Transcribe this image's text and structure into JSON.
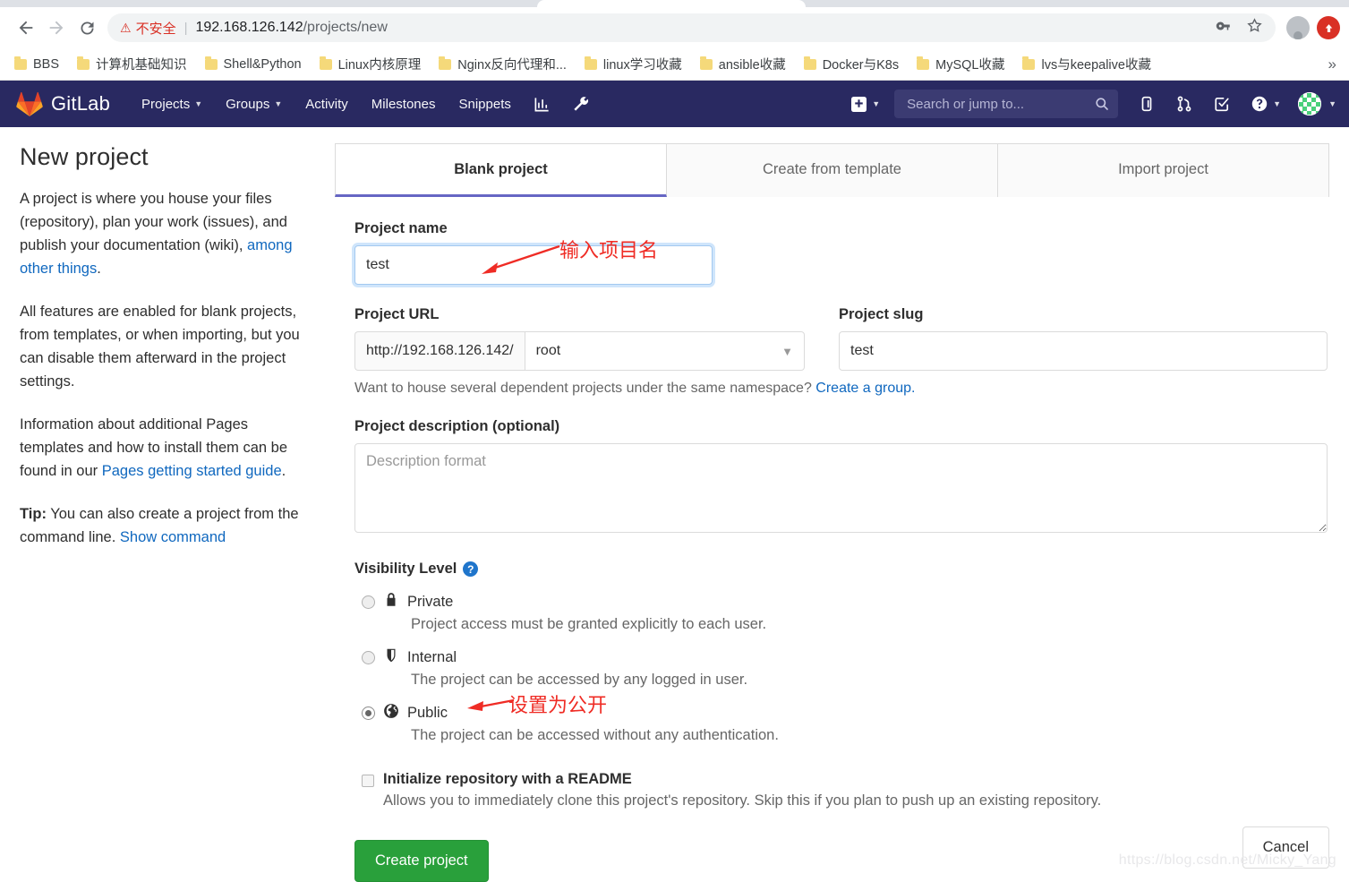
{
  "browser": {
    "back_icon": "back-arrow-icon",
    "forward_icon": "forward-arrow-icon",
    "reload_icon": "reload-icon",
    "security_warning": "不安全",
    "url_host": "192.168.126.142",
    "url_path": "/projects/new",
    "key_icon": "key-icon",
    "star_icon": "star-icon",
    "profile_icon": "profile-avatar-icon",
    "extension_icon": "extension-icon",
    "bookmarks": [
      "BBS",
      "计算机基础知识",
      "Shell&Python",
      "Linux内核原理",
      "Nginx反向代理和...",
      "linux学习收藏",
      "ansible收藏",
      "Docker与K8s",
      "MySQL收藏",
      "lvs与keepalive收藏"
    ],
    "bookmarks_overflow": "»"
  },
  "gitlab_nav": {
    "brand": "GitLab",
    "links": [
      {
        "label": "Projects",
        "has_caret": true
      },
      {
        "label": "Groups",
        "has_caret": true
      },
      {
        "label": "Activity",
        "has_caret": false
      },
      {
        "label": "Milestones",
        "has_caret": false
      },
      {
        "label": "Snippets",
        "has_caret": false
      }
    ],
    "icon_links": [
      "analytics-icon",
      "wrench-icon"
    ],
    "plus_icon": "plus-square-icon",
    "search_placeholder": "Search or jump to...",
    "search_value": "",
    "search_icon": "search-icon",
    "right_icons": [
      "issues-icon",
      "merge-requests-icon",
      "todos-icon",
      "help-icon"
    ],
    "avatar": "user-avatar-identicon",
    "nav_bg": "#292961"
  },
  "sidebar": {
    "title": "New project",
    "p1_a": "A project is where you house your files (repository), plan your work (issues), and publish your documentation (wiki), ",
    "p1_link": "among other things",
    "p1_b": ".",
    "p2": "All features are enabled for blank projects, from templates, or when importing, but you can disable them afterward in the project settings.",
    "p3_a": "Information about additional Pages templates and how to install them can be found in our ",
    "p3_link": "Pages getting started guide",
    "p3_b": ".",
    "p4_tip": "Tip:",
    "p4_a": " You can also create a project from the command line. ",
    "p4_link": "Show command"
  },
  "tabs": [
    {
      "label": "Blank project",
      "active": true
    },
    {
      "label": "Create from template",
      "active": false
    },
    {
      "label": "Import project",
      "active": false
    }
  ],
  "form": {
    "project_name_label": "Project name",
    "project_name_value": "test",
    "project_name_placeholder": "",
    "project_url_label": "Project URL",
    "url_prefix": "http://192.168.126.142/",
    "namespace_value": "root",
    "namespace_caret": "chevron-down-icon",
    "project_slug_label": "Project slug",
    "project_slug_value": "test",
    "namespace_hint_text": "Want to house several dependent projects under the same namespace? ",
    "namespace_hint_link": "Create a group.",
    "description_label": "Project description (optional)",
    "description_placeholder": "Description format",
    "description_value": "",
    "visibility_label": "Visibility Level",
    "visibility_help_icon": "question-mark-icon",
    "visibility_options": [
      {
        "name": "Private",
        "icon": "lock-icon",
        "desc": "Project access must be granted explicitly to each user.",
        "selected": false
      },
      {
        "name": "Internal",
        "icon": "shield-icon",
        "desc": "The project can be accessed by any logged in user.",
        "selected": false
      },
      {
        "name": "Public",
        "icon": "globe-icon",
        "desc": "The project can be accessed without any authentication.",
        "selected": true
      }
    ],
    "readme_label": "Initialize repository with a README",
    "readme_desc": "Allows you to immediately clone this project's repository. Skip this if you plan to push up an existing repository.",
    "readme_checked": false,
    "create_button": "Create project",
    "cancel_button": "Cancel",
    "create_button_color": "#29a03b"
  },
  "annotations": [
    {
      "text": "输入项目名",
      "color": "#ef2c25"
    },
    {
      "text": "设置为公开",
      "color": "#ef2c25"
    }
  ],
  "watermark": "https://blog.csdn.net/Micky_Yang"
}
